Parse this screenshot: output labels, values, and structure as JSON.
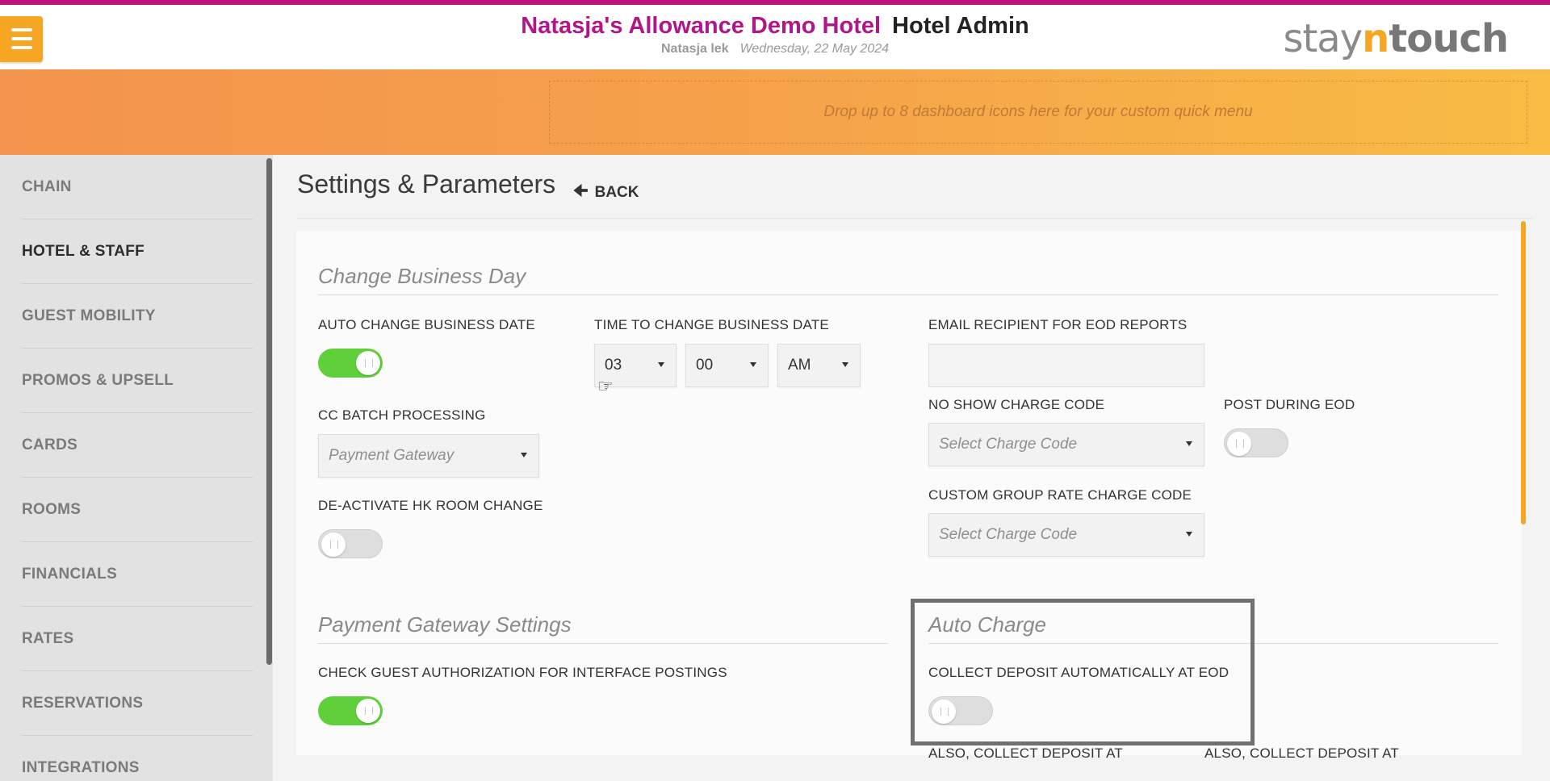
{
  "header": {
    "hotel_name": "Natasja's Allowance Demo Hotel",
    "app_title": "Hotel Admin",
    "user_name": "Natasja lek",
    "date": "Wednesday, 22 May 2024",
    "logo_stay": "stay",
    "logo_n": "n",
    "logo_touch": "touch",
    "menu_icon": "hamburger-icon"
  },
  "quick_menu": {
    "placeholder": "Drop up to 8 dashboard icons here for your custom quick menu"
  },
  "sidebar": {
    "items": [
      {
        "label": "CHAIN",
        "active": false
      },
      {
        "label": "HOTEL & STAFF",
        "active": true
      },
      {
        "label": "GUEST MOBILITY",
        "active": false
      },
      {
        "label": "PROMOS & UPSELL",
        "active": false
      },
      {
        "label": "CARDS",
        "active": false
      },
      {
        "label": "ROOMS",
        "active": false
      },
      {
        "label": "FINANCIALS",
        "active": false
      },
      {
        "label": "RATES",
        "active": false
      },
      {
        "label": "RESERVATIONS",
        "active": false
      },
      {
        "label": "INTEGRATIONS",
        "active": false
      }
    ]
  },
  "page": {
    "title": "Settings & Parameters",
    "back_label": "BACK"
  },
  "change_business_day": {
    "title": "Change Business Day",
    "auto_change_label": "AUTO CHANGE BUSINESS DATE",
    "auto_change_on": true,
    "time_label": "TIME TO CHANGE BUSINESS DATE",
    "time_hour": "03",
    "time_minute": "00",
    "time_ampm": "AM",
    "email_label": "EMAIL RECIPIENT FOR EOD REPORTS",
    "email_value": "",
    "cc_batch_label": "CC BATCH PROCESSING",
    "cc_batch_placeholder": "Payment Gateway",
    "no_show_label": "NO SHOW CHARGE CODE",
    "no_show_placeholder": "Select Charge Code",
    "post_during_eod_label": "POST DURING EOD",
    "post_during_eod_on": false,
    "deactivate_hk_label": "DE-ACTIVATE HK ROOM CHANGE",
    "deactivate_hk_on": false,
    "custom_group_label": "CUSTOM GROUP RATE CHARGE CODE",
    "custom_group_placeholder": "Select Charge Code"
  },
  "payment_gateway": {
    "title": "Payment Gateway Settings",
    "check_auth_label": "CHECK GUEST AUTHORIZATION FOR INTERFACE POSTINGS",
    "check_auth_on": true
  },
  "auto_charge": {
    "title": "Auto Charge",
    "collect_deposit_label": "COLLECT DEPOSIT AUTOMATICALLY AT EOD",
    "collect_deposit_on": false,
    "also_collect_1": "ALSO, COLLECT DEPOSIT AT",
    "also_collect_2": "ALSO, COLLECT DEPOSIT AT"
  },
  "colors": {
    "accent_orange": "#f6a623",
    "brand_magenta": "#b0158a",
    "toggle_on": "#5fd03a"
  }
}
